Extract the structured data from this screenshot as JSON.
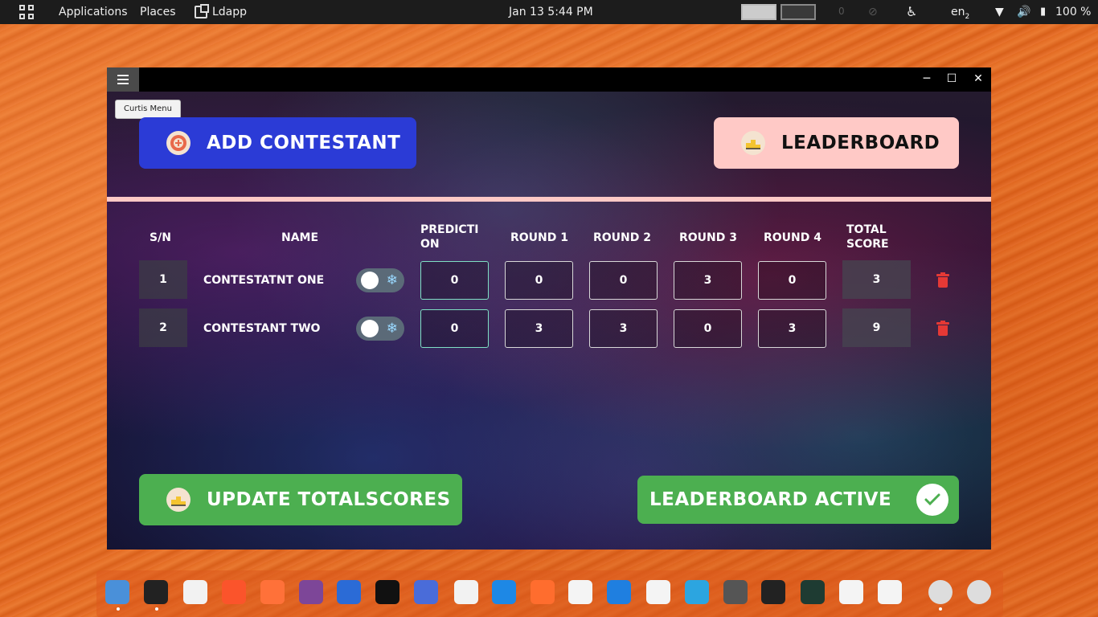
{
  "topbar": {
    "applications": "Applications",
    "places": "Places",
    "app_name": "Ldapp",
    "datetime": "Jan 13   5:44 PM",
    "workspace_hint": "0",
    "lang": "en",
    "lang_sub": "2",
    "battery": "100 %"
  },
  "window": {
    "tooltip": "Curtis Menu",
    "controls": {
      "minimize": "─",
      "maximize": "☐",
      "close": "✕"
    }
  },
  "buttons": {
    "add_contestant": "ADD CONTESTANT",
    "leaderboard": "LEADERBOARD",
    "update_totals": "UPDATE TOTALSCORES",
    "leaderboard_active": "LEADERBOARD ACTIVE"
  },
  "table": {
    "headers": {
      "sn": "S/N",
      "name": "NAME",
      "prediction_1": "PREDICTI",
      "prediction_2": "ON",
      "round1": "ROUND 1",
      "round2": "ROUND 2",
      "round3": "ROUND 3",
      "round4": "ROUND 4",
      "total_1": "TOTAL",
      "total_2": "SCORE"
    },
    "rows": [
      {
        "sn": "1",
        "name": "CONTESTATNT ONE",
        "prediction": "0",
        "round1": "0",
        "round2": "0",
        "round3": "3",
        "round4": "0",
        "total": "3"
      },
      {
        "sn": "2",
        "name": "CONTESTANT TWO",
        "prediction": "0",
        "round1": "3",
        "round2": "3",
        "round3": "0",
        "round4": "3",
        "total": "9"
      }
    ]
  },
  "colors": {
    "add_button": "#2b3bd6",
    "leaderboard_button": "#ffc9c6",
    "green_button": "#4caf50",
    "delete_icon": "#e53935",
    "prediction_border": "#7fe0c4"
  },
  "dock": {
    "icons": [
      "files-icon",
      "terminal-icon",
      "text-editor-icon",
      "brave-icon",
      "firefox-icon",
      "tor-icon",
      "bird-icon",
      "download-icon",
      "remote-desktop-icon",
      "font-viewer-icon",
      "browser-icon",
      "paint-icon",
      "vpn-icon",
      "vscode-icon",
      "slack-icon",
      "telegram-icon",
      "calculator-icon",
      "amazon-icon",
      "system-monitor-icon",
      "color-picker-icon",
      "games-icon",
      "settings-icon",
      "app-grid-icon"
    ]
  }
}
